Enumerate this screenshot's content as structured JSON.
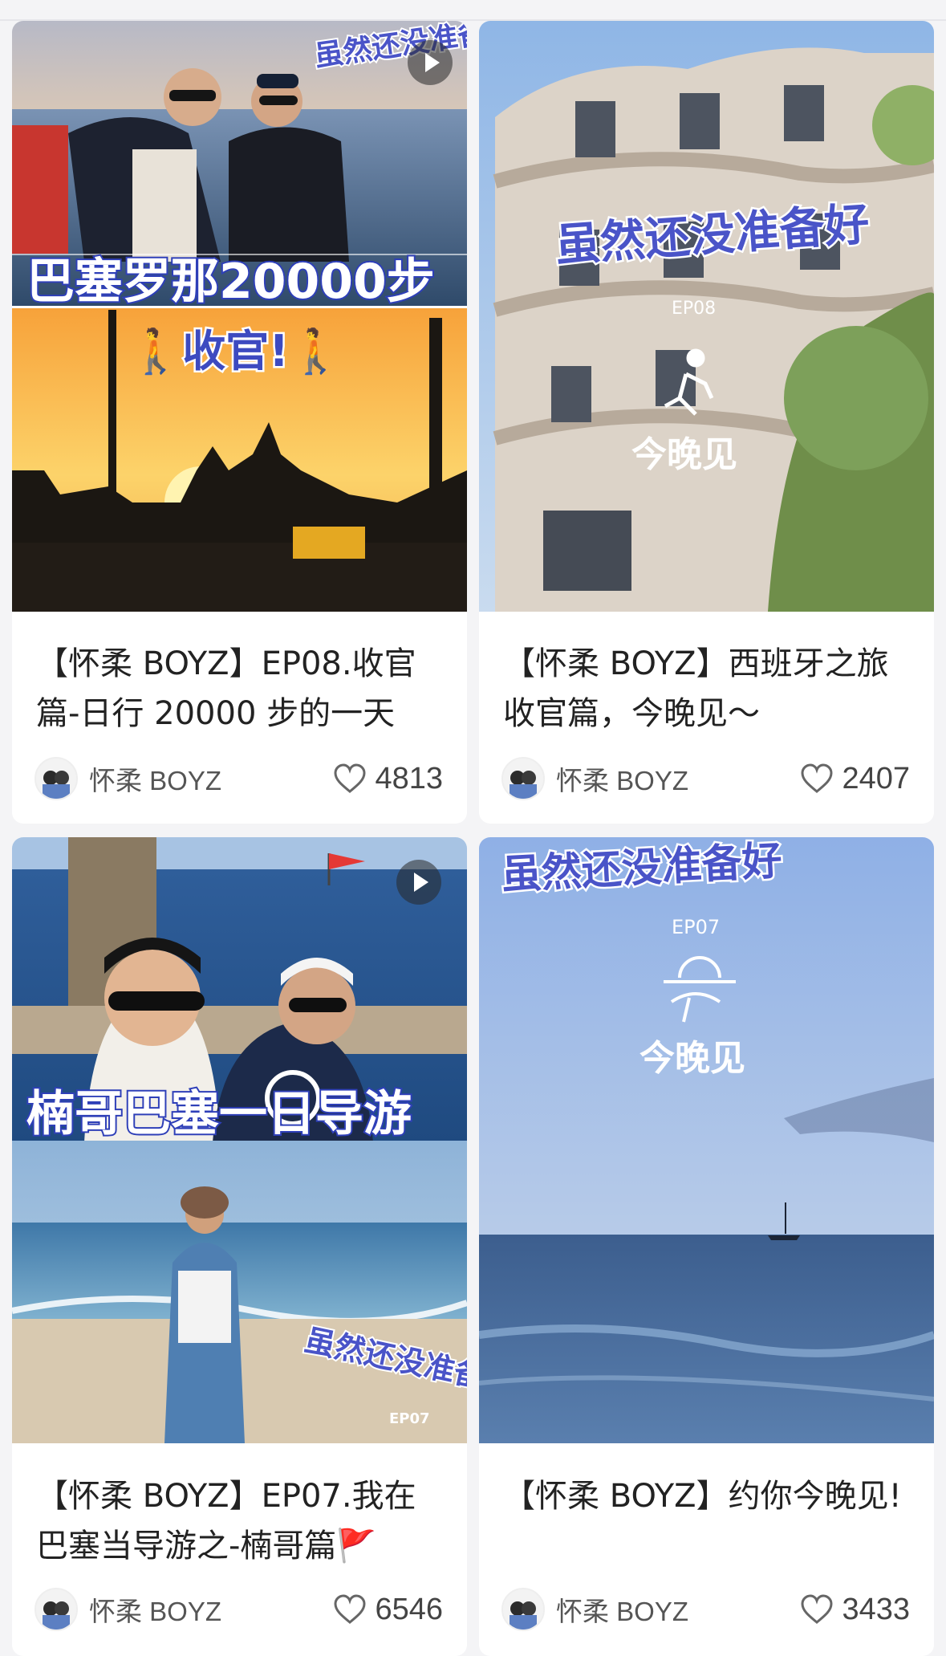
{
  "feed": {
    "cards": [
      {
        "title": "【怀柔 BOYZ】EP08.收官篇-日行 20000 步的一天",
        "author": "怀柔 BOYZ",
        "likes": "4813",
        "cover_text": {
          "sticker": "虽然还没准备好",
          "headline": "巴塞罗那20000步",
          "subline": "🚶收官!🚶"
        }
      },
      {
        "title": "【怀柔 BOYZ】西班牙之旅收官篇，今晚见～",
        "author": "怀柔 BOYZ",
        "likes": "2407",
        "cover_text": {
          "sticker": "虽然还没准备好",
          "episode": "EP08",
          "caption": "今晚见"
        }
      },
      {
        "title": "【怀柔 BOYZ】EP07.我在巴塞当导游之-楠哥篇🚩",
        "author": "怀柔 BOYZ",
        "likes": "6546",
        "cover_text": {
          "headline": "楠哥巴塞一日导游",
          "sticker": "虽然还没准备好",
          "episode": "EP07"
        }
      },
      {
        "title": "【怀柔 BOYZ】约你今晚见!",
        "author": "怀柔 BOYZ",
        "likes": "3433",
        "cover_text": {
          "sticker": "虽然还没准备好",
          "episode": "EP07",
          "caption": "今晚见"
        }
      }
    ]
  },
  "colors": {
    "accent": "#4a54c8",
    "like_icon": "#666666",
    "card_bg": "#ffffff",
    "page_bg": "#f4f4f6"
  },
  "icons": {
    "like": "heart-outline-icon",
    "play": "play-icon"
  }
}
